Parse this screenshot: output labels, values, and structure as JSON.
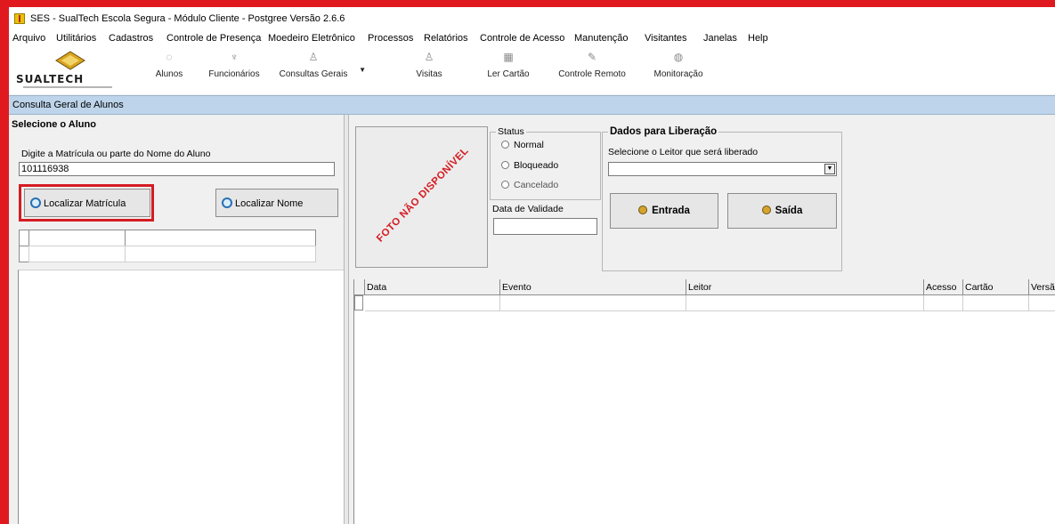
{
  "window": {
    "title": "SES - SualTech Escola Segura - Módulo Cliente - Postgree Versão 2.6.6"
  },
  "menu": [
    "Arquivo",
    "Utilitários",
    "Cadastros",
    "Controle de Presença",
    "Moedeiro Eletrônico",
    "Processos",
    "Relatórios",
    "Controle de Acesso",
    "Manutenção",
    "Visitantes",
    "Janelas",
    "Help"
  ],
  "brand": {
    "name": "SUALTECH"
  },
  "toolbar": [
    {
      "label": "Alunos",
      "icon": "student-icon"
    },
    {
      "label": "Funcionários",
      "icon": "staff-icon"
    },
    {
      "label": "Consultas Gerais",
      "icon": "query-icon"
    },
    {
      "label": "Visitas",
      "icon": "visitors-icon"
    },
    {
      "label": "Ler Cartão",
      "icon": "card-reader-icon"
    },
    {
      "label": "Controle Remoto",
      "icon": "remote-control-icon"
    },
    {
      "label": "Monitoração",
      "icon": "monitor-icon"
    }
  ],
  "panel": {
    "title": "Consulta Geral de Alunos"
  },
  "search": {
    "heading": "Selecione o Aluno",
    "hint": "Digite a Matrícula ou parte do Nome do Aluno",
    "value": "101116938",
    "btn_matricula": "Localizar Matrícula",
    "btn_nome": "Localizar Nome"
  },
  "photo": {
    "placeholder": "FOTO NÃO DISPONÍVEL"
  },
  "status": {
    "legend": "Status",
    "options": [
      "Normal",
      "Bloqueado",
      "Cancelado"
    ],
    "validade_label": "Data de Validade",
    "validade_value": ""
  },
  "liberacao": {
    "legend": "Dados para Liberação",
    "reader_label": "Selecione o Leitor que será liberado",
    "reader_value": "",
    "btn_entrada": "Entrada",
    "btn_saida": "Saída"
  },
  "events": {
    "columns": [
      "Data",
      "Evento",
      "Leitor",
      "Acesso",
      "Cartão",
      "Versão"
    ],
    "rows": []
  },
  "colors": {
    "highlight": "#d41c22",
    "panel_header": "#bdd4ea",
    "window_bg": "#f0f0f0"
  }
}
